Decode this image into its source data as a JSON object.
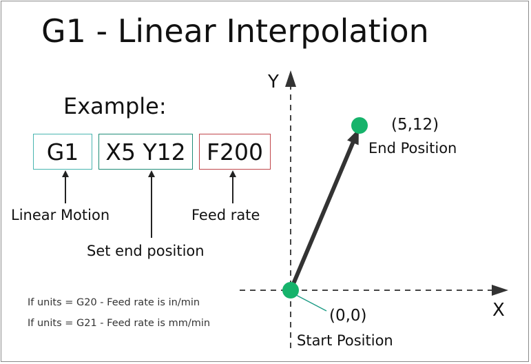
{
  "title": "G1 - Linear Interpolation",
  "example": {
    "heading": "Example:",
    "segments": [
      {
        "code": "G1",
        "label": "Linear Motion",
        "color": "#48b5b0"
      },
      {
        "code": "X5 Y12",
        "label": "Set end position",
        "color": "#1e8c77"
      },
      {
        "code": "F200",
        "label": "Feed rate",
        "color": "#c0454a"
      }
    ]
  },
  "notes": [
    "If units = G20 - Feed rate is in/min",
    "If units = G21 - Feed rate is mm/min"
  ],
  "axes": {
    "x_label": "X",
    "y_label": "Y"
  },
  "points": {
    "start": {
      "coord": "(0,0)",
      "label": "Start Position"
    },
    "end": {
      "coord": "(5,12)",
      "label": "End Position"
    }
  },
  "colors": {
    "point": "#16b36b",
    "path": "#333333",
    "leader": "#1e9c86"
  }
}
